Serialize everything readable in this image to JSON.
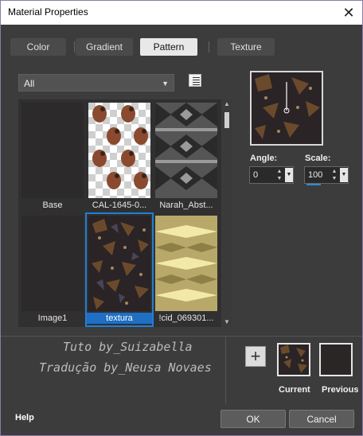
{
  "window": {
    "title": "Material Properties"
  },
  "tabs": [
    {
      "label": "Color",
      "active": false
    },
    {
      "label": "Gradient",
      "active": false
    },
    {
      "label": "Pattern",
      "active": true
    },
    {
      "label": "Texture",
      "active": false
    }
  ],
  "category": {
    "selected": "All"
  },
  "patterns": [
    {
      "label": "Base",
      "thumb": "dark"
    },
    {
      "label": "CAL-1645-0...",
      "thumb": "checker-bird"
    },
    {
      "label": "Narah_Abst...",
      "thumb": "grey-abstract"
    },
    {
      "label": "Image1",
      "thumb": "dark"
    },
    {
      "label": "textura",
      "thumb": "textura",
      "selected": true
    },
    {
      "label": "!cid_069301...",
      "thumb": "gold-diamond"
    }
  ],
  "angle": {
    "label": "Angle:",
    "value": "0"
  },
  "scale": {
    "label": "Scale:",
    "value": "100"
  },
  "watermark": {
    "line1": "Tuto by_Suizabella",
    "line2": "Tradução by_Neusa Novaes"
  },
  "swatches": {
    "current_label": "Current",
    "previous_label": "Previous"
  },
  "buttons": {
    "help": "Help",
    "ok": "OK",
    "cancel": "Cancel"
  },
  "colors": {
    "dialog_bg": "#3c3c3c",
    "active_tab": "#e8e8e8",
    "selection": "#1f6fc4",
    "previous_swatch": "#2b2626"
  }
}
